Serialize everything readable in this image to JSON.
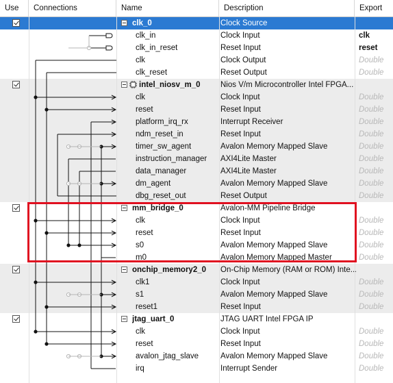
{
  "columns": {
    "use": "Use",
    "connections": "Connections",
    "name": "Name",
    "description": "Description",
    "export": "Export"
  },
  "rows": [
    {
      "type": "comp",
      "name": "clk_0",
      "desc": "Clock Source",
      "export": "",
      "use": true,
      "selected": true,
      "chip": false
    },
    {
      "type": "port",
      "name": "clk_in",
      "desc": "Clock Input",
      "export": "clk",
      "exportStyle": "bold"
    },
    {
      "type": "port",
      "name": "clk_in_reset",
      "desc": "Reset Input",
      "export": "reset",
      "exportStyle": "bold"
    },
    {
      "type": "port",
      "name": "clk",
      "desc": "Clock Output",
      "export": "Double",
      "exportStyle": "ital"
    },
    {
      "type": "port",
      "name": "clk_reset",
      "desc": "Reset Output",
      "export": "Double",
      "exportStyle": "ital"
    },
    {
      "type": "comp",
      "name": "intel_niosv_m_0",
      "desc": "Nios V/m Microcontroller Intel FPGA...",
      "export": "",
      "use": true,
      "chip": true
    },
    {
      "type": "port",
      "name": "clk",
      "desc": "Clock Input",
      "export": "Double",
      "exportStyle": "ital"
    },
    {
      "type": "port",
      "name": "reset",
      "desc": "Reset Input",
      "export": "Double",
      "exportStyle": "ital"
    },
    {
      "type": "port",
      "name": "platform_irq_rx",
      "desc": "Interrupt Receiver",
      "export": "Double",
      "exportStyle": "ital"
    },
    {
      "type": "port",
      "name": "ndm_reset_in",
      "desc": "Reset Input",
      "export": "Double",
      "exportStyle": "ital"
    },
    {
      "type": "port",
      "name": "timer_sw_agent",
      "desc": "Avalon Memory Mapped Slave",
      "export": "Double",
      "exportStyle": "ital"
    },
    {
      "type": "port",
      "name": "instruction_manager",
      "desc": "AXI4Lite Master",
      "export": "Double",
      "exportStyle": "ital"
    },
    {
      "type": "port",
      "name": "data_manager",
      "desc": "AXI4Lite Master",
      "export": "Double",
      "exportStyle": "ital"
    },
    {
      "type": "port",
      "name": "dm_agent",
      "desc": "Avalon Memory Mapped Slave",
      "export": "Double",
      "exportStyle": "ital"
    },
    {
      "type": "port",
      "name": "dbg_reset_out",
      "desc": "Reset Output",
      "export": "Double",
      "exportStyle": "ital"
    },
    {
      "type": "comp",
      "name": "mm_bridge_0",
      "desc": "Avalon-MM Pipeline Bridge",
      "export": "",
      "use": true,
      "chip": false
    },
    {
      "type": "port",
      "name": "clk",
      "desc": "Clock Input",
      "export": "Double",
      "exportStyle": "ital"
    },
    {
      "type": "port",
      "name": "reset",
      "desc": "Reset Input",
      "export": "Double",
      "exportStyle": "ital"
    },
    {
      "type": "port",
      "name": "s0",
      "desc": "Avalon Memory Mapped Slave",
      "export": "Double",
      "exportStyle": "ital"
    },
    {
      "type": "port",
      "name": "m0",
      "desc": "Avalon Memory Mapped Master",
      "export": "Double",
      "exportStyle": "ital"
    },
    {
      "type": "comp",
      "name": "onchip_memory2_0",
      "desc": "On-Chip Memory (RAM or ROM) Inte...",
      "export": "",
      "use": true,
      "chip": false
    },
    {
      "type": "port",
      "name": "clk1",
      "desc": "Clock Input",
      "export": "Double",
      "exportStyle": "ital"
    },
    {
      "type": "port",
      "name": "s1",
      "desc": "Avalon Memory Mapped Slave",
      "export": "Double",
      "exportStyle": "ital"
    },
    {
      "type": "port",
      "name": "reset1",
      "desc": "Reset Input",
      "export": "Double",
      "exportStyle": "ital"
    },
    {
      "type": "comp",
      "name": "jtag_uart_0",
      "desc": "JTAG UART Intel FPGA IP",
      "export": "",
      "use": true,
      "chip": false
    },
    {
      "type": "port",
      "name": "clk",
      "desc": "Clock Input",
      "export": "Double",
      "exportStyle": "ital"
    },
    {
      "type": "port",
      "name": "reset",
      "desc": "Reset Input",
      "export": "Double",
      "exportStyle": "ital"
    },
    {
      "type": "port",
      "name": "avalon_jtag_slave",
      "desc": "Avalon Memory Mapped Slave",
      "export": "Double",
      "exportStyle": "ital"
    },
    {
      "type": "port",
      "name": "irq",
      "desc": "Interrupt Sender",
      "export": "Double",
      "exportStyle": "ital"
    }
  ],
  "colors": {
    "selected": "#2b7ad2",
    "groupAlt": "#ececec",
    "highlight": "#e01020",
    "wire": "#111111",
    "wireGhost": "#b5b5b5"
  }
}
